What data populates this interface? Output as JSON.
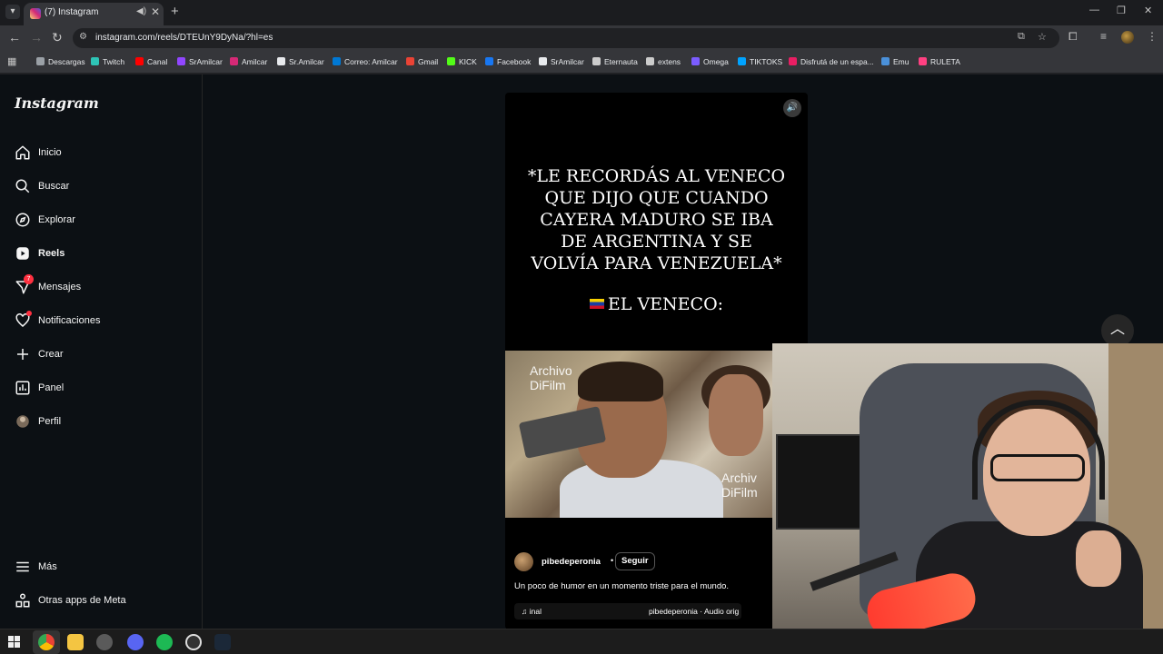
{
  "browser": {
    "tab_title": "(7) Instagram",
    "url": "instagram.com/reels/DTEUnY9DyNa/?hl=es",
    "bookmarks": [
      {
        "label": "Descargas",
        "color": "#9aa0a6"
      },
      {
        "label": "Twitch",
        "color": "#2ec4b6"
      },
      {
        "label": "Canal",
        "color": "#ff0000"
      },
      {
        "label": "SrAmilcar",
        "color": "#9146ff"
      },
      {
        "label": "Amilcar",
        "color": "#d62976"
      },
      {
        "label": "Sr.Amilcar",
        "color": "#e8eaed"
      },
      {
        "label": "Correo: Amilcar",
        "color": "#0078d4"
      },
      {
        "label": "Gmail",
        "color": "#ea4335"
      },
      {
        "label": "KICK",
        "color": "#53fc18"
      },
      {
        "label": "Facebook",
        "color": "#1877f2"
      },
      {
        "label": "SrAmilcar",
        "color": "#e8eaed"
      },
      {
        "label": "Eternauta",
        "color": "#cccccc"
      },
      {
        "label": "extens",
        "color": "#cccccc"
      },
      {
        "label": "Omega",
        "color": "#7b5cff"
      },
      {
        "label": "TIKTOKS",
        "color": "#00a3ff"
      },
      {
        "label": "Disfrutá de un espa...",
        "color": "#e91e63"
      },
      {
        "label": "Emu",
        "color": "#4a90d9"
      },
      {
        "label": "RULETA",
        "color": "#ff4081"
      }
    ]
  },
  "sidebar": {
    "logo": "Instagram",
    "items": [
      {
        "label": "Inicio",
        "icon": "home-icon"
      },
      {
        "label": "Buscar",
        "icon": "search-icon"
      },
      {
        "label": "Explorar",
        "icon": "compass-icon"
      },
      {
        "label": "Reels",
        "icon": "reels-icon"
      },
      {
        "label": "Mensajes",
        "icon": "messages-icon",
        "badge": "7"
      },
      {
        "label": "Notificaciones",
        "icon": "heart-icon"
      },
      {
        "label": "Crear",
        "icon": "plus-icon"
      },
      {
        "label": "Panel",
        "icon": "chart-icon"
      },
      {
        "label": "Perfil",
        "icon": "profile-avatar-icon"
      }
    ],
    "bottom": [
      {
        "label": "Más",
        "icon": "menu-icon"
      },
      {
        "label": "Otras apps de Meta",
        "icon": "meta-apps-icon"
      }
    ]
  },
  "reel": {
    "caption_lines": [
      "*LE RECORDÁS AL VENECO",
      "QUE DIJO QUE CUANDO",
      "CAYERA MADURO SE IBA",
      "DE ARGENTINA Y SE",
      "VOLVÍA PARA VENEZUELA*"
    ],
    "veneco": "EL VENECO:",
    "watermark_top": [
      "Archivo",
      "DiFilm"
    ],
    "watermark_bottom": [
      "Archiv",
      "DiFilm"
    ],
    "author": "pibedeperonia",
    "follow": "Seguir",
    "description": "Un poco de humor en un momento triste para el mundo.",
    "audio_left": "inal",
    "audio_right": "pibedeperonia · Audio orig"
  },
  "colors": {
    "page_bg": "#0c1014",
    "badge": "#ff3040",
    "chrome_toolbar": "#35363a"
  }
}
